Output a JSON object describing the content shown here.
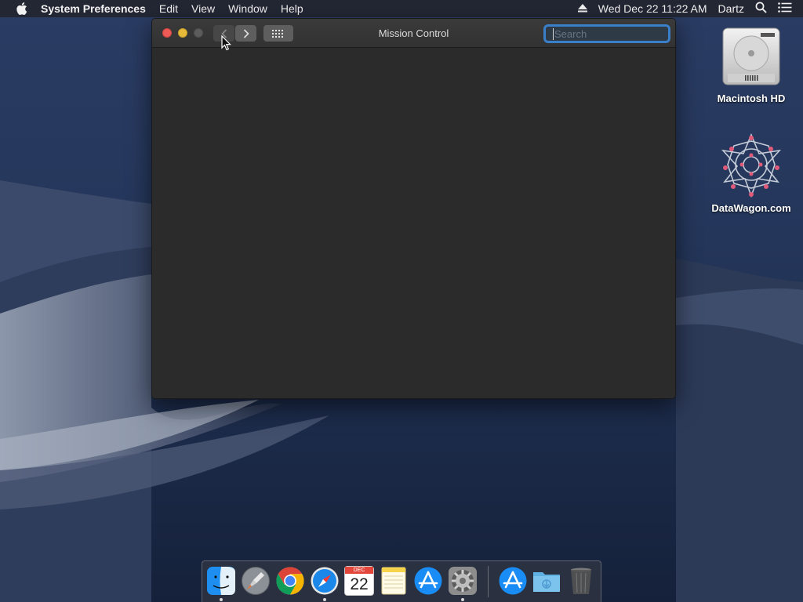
{
  "menubar": {
    "app_name": "System Preferences",
    "menus": [
      "Edit",
      "View",
      "Window",
      "Help"
    ],
    "clock": "Wed Dec 22  11:22 AM",
    "user": "Dartz"
  },
  "window": {
    "title": "Mission Control",
    "search_placeholder": "Search"
  },
  "desktop_icons": [
    {
      "label": "Macintosh HD"
    },
    {
      "label": "DataWagon.com"
    }
  ],
  "dock": {
    "calendar_month": "DEC",
    "calendar_day": "22",
    "apps": [
      "Finder",
      "Launchpad",
      "Google Chrome",
      "Safari",
      "Calendar",
      "Notes",
      "App Store",
      "System Preferences",
      "App Store",
      "Downloads",
      "Trash"
    ]
  },
  "colors": {
    "close": "#ec5b55",
    "minimize": "#e6b938",
    "search_focus": "#3a7fc9"
  }
}
